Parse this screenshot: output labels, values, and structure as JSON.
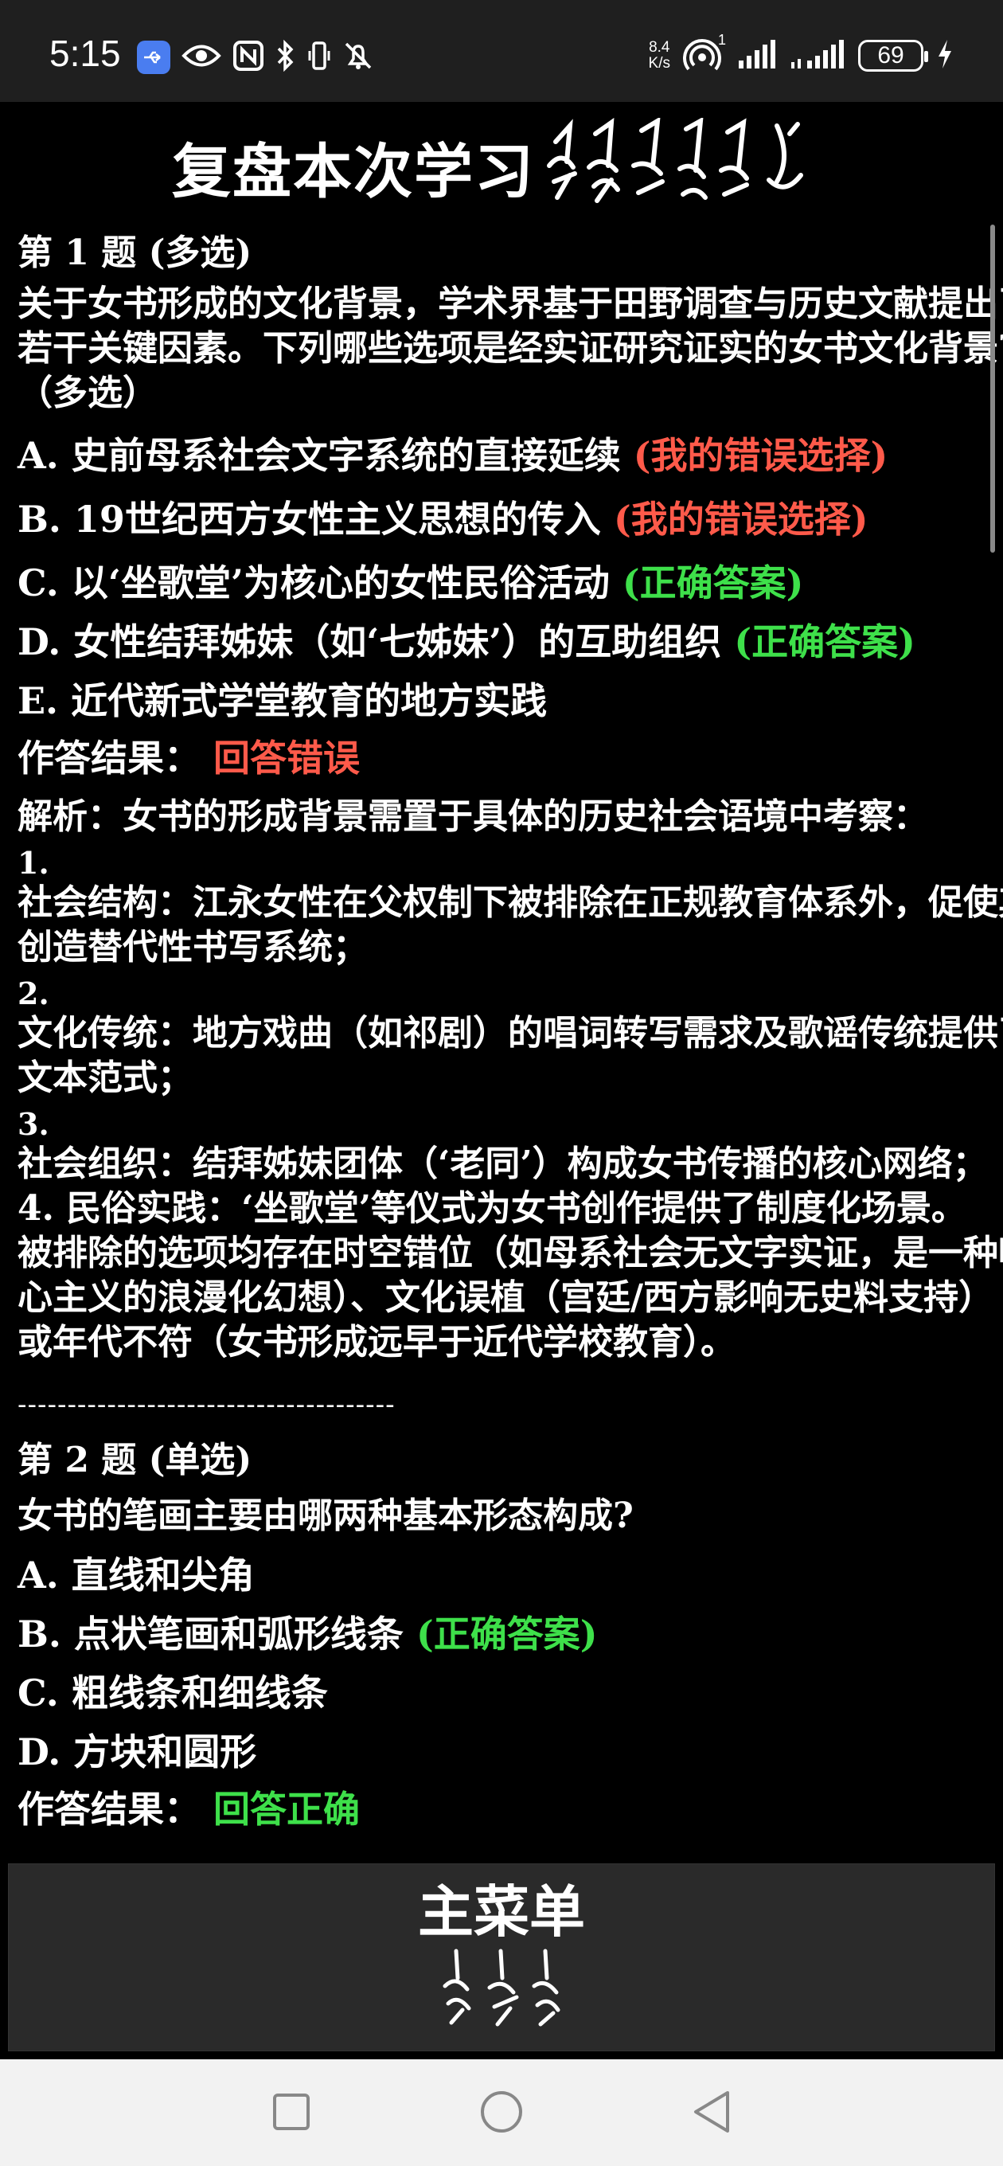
{
  "status_bar": {
    "time": "5:15",
    "net_speed_value": "8.4",
    "net_speed_unit": "K/s",
    "hotspot_count": "1",
    "battery_level": "69",
    "icons": [
      "usb-icon",
      "eye-icon",
      "nfc-icon",
      "bluetooth-icon",
      "vibrate-icon",
      "mute-icon",
      "hotspot-icon",
      "signal-icon",
      "signal-icon",
      "charging-icon"
    ]
  },
  "header": {
    "title": "复盘本次学习"
  },
  "questions": [
    {
      "title": "第 1 题 (多选)",
      "stem": [
        "关于女书形成的文化背景，学术界基于田野调查与历史文献提出了",
        "若干关键因素。下列哪些选项是经实证研究证实的女书文化背景?",
        "（多选）"
      ],
      "options": [
        {
          "text": "A. 史前母系社会文字系统的直接延续",
          "tag": "(我的错误选择)",
          "tag_type": "wrong"
        },
        {
          "text": "B. 19世纪西方女性主义思想的传入",
          "tag": "(我的错误选择)",
          "tag_type": "wrong"
        },
        {
          "text": "C. 以‘坐歌堂’为核心的女性民俗活动",
          "tag": "(正确答案)",
          "tag_type": "correct"
        },
        {
          "text": "D. 女性结拜姊妹（如‘七姊妹’）的互助组织",
          "tag": "(正确答案)",
          "tag_type": "correct"
        },
        {
          "text": "E. 近代新式学堂教育的地方实践",
          "tag": "",
          "tag_type": "none"
        }
      ],
      "result_label": "作答结果：",
      "result_value": "回答错误",
      "result_type": "wrong",
      "analysis": {
        "intro": "解析：女书的形成背景需置于具体的历史社会语境中考察：",
        "p1_num": "1.",
        "p1": [
          "社会结构：江永女性在父权制下被排除在正规教育体系外，促使其",
          "创造替代性书写系统；"
        ],
        "p2_num": "2.",
        "p2": [
          "文化传统：地方戏曲（如祁剧）的唱词转写需求及歌谣传统提供了",
          "文本范式；"
        ],
        "p3_num": "3.",
        "p3": [
          "社会组织：结拜姊妹团体（‘老同’）构成女书传播的核心网络；"
        ],
        "p4": [
          "4. 民俗实践：‘坐歌堂’等仪式为女书创作提供了制度化场景。"
        ],
        "conclusion": [
          "被排除的选项均存在时空错位（如母系社会无文字实证，是一种唯",
          "心主义的浪漫化幻想）、文化误植（宫廷/西方影响无史料支持）",
          "或年代不符（女书形成远早于近代学校教育）。"
        ]
      }
    },
    {
      "title": "第 2 题 (单选)",
      "stem": [
        "女书的笔画主要由哪两种基本形态构成?"
      ],
      "options": [
        {
          "text": "A. 直线和尖角",
          "tag": "",
          "tag_type": "none"
        },
        {
          "text": "B. 点状笔画和弧形线条",
          "tag": "(正确答案)",
          "tag_type": "correct"
        },
        {
          "text": "C. 粗线条和细线条",
          "tag": "",
          "tag_type": "none"
        },
        {
          "text": "D. 方块和圆形",
          "tag": "",
          "tag_type": "none"
        }
      ],
      "result_label": "作答结果：",
      "result_value": "回答正确",
      "result_type": "correct"
    }
  ],
  "divider": "--------------------------------------",
  "main_menu": {
    "label": "主菜单"
  },
  "nav_bar": {
    "icons": [
      "recents-icon",
      "home-icon",
      "back-icon"
    ]
  },
  "colors": {
    "wrong": "#ff5a4a",
    "correct": "#3ee04a",
    "background": "#000000",
    "status_bar": "#1f1f1f",
    "menu_button": "#2a2a2a"
  }
}
